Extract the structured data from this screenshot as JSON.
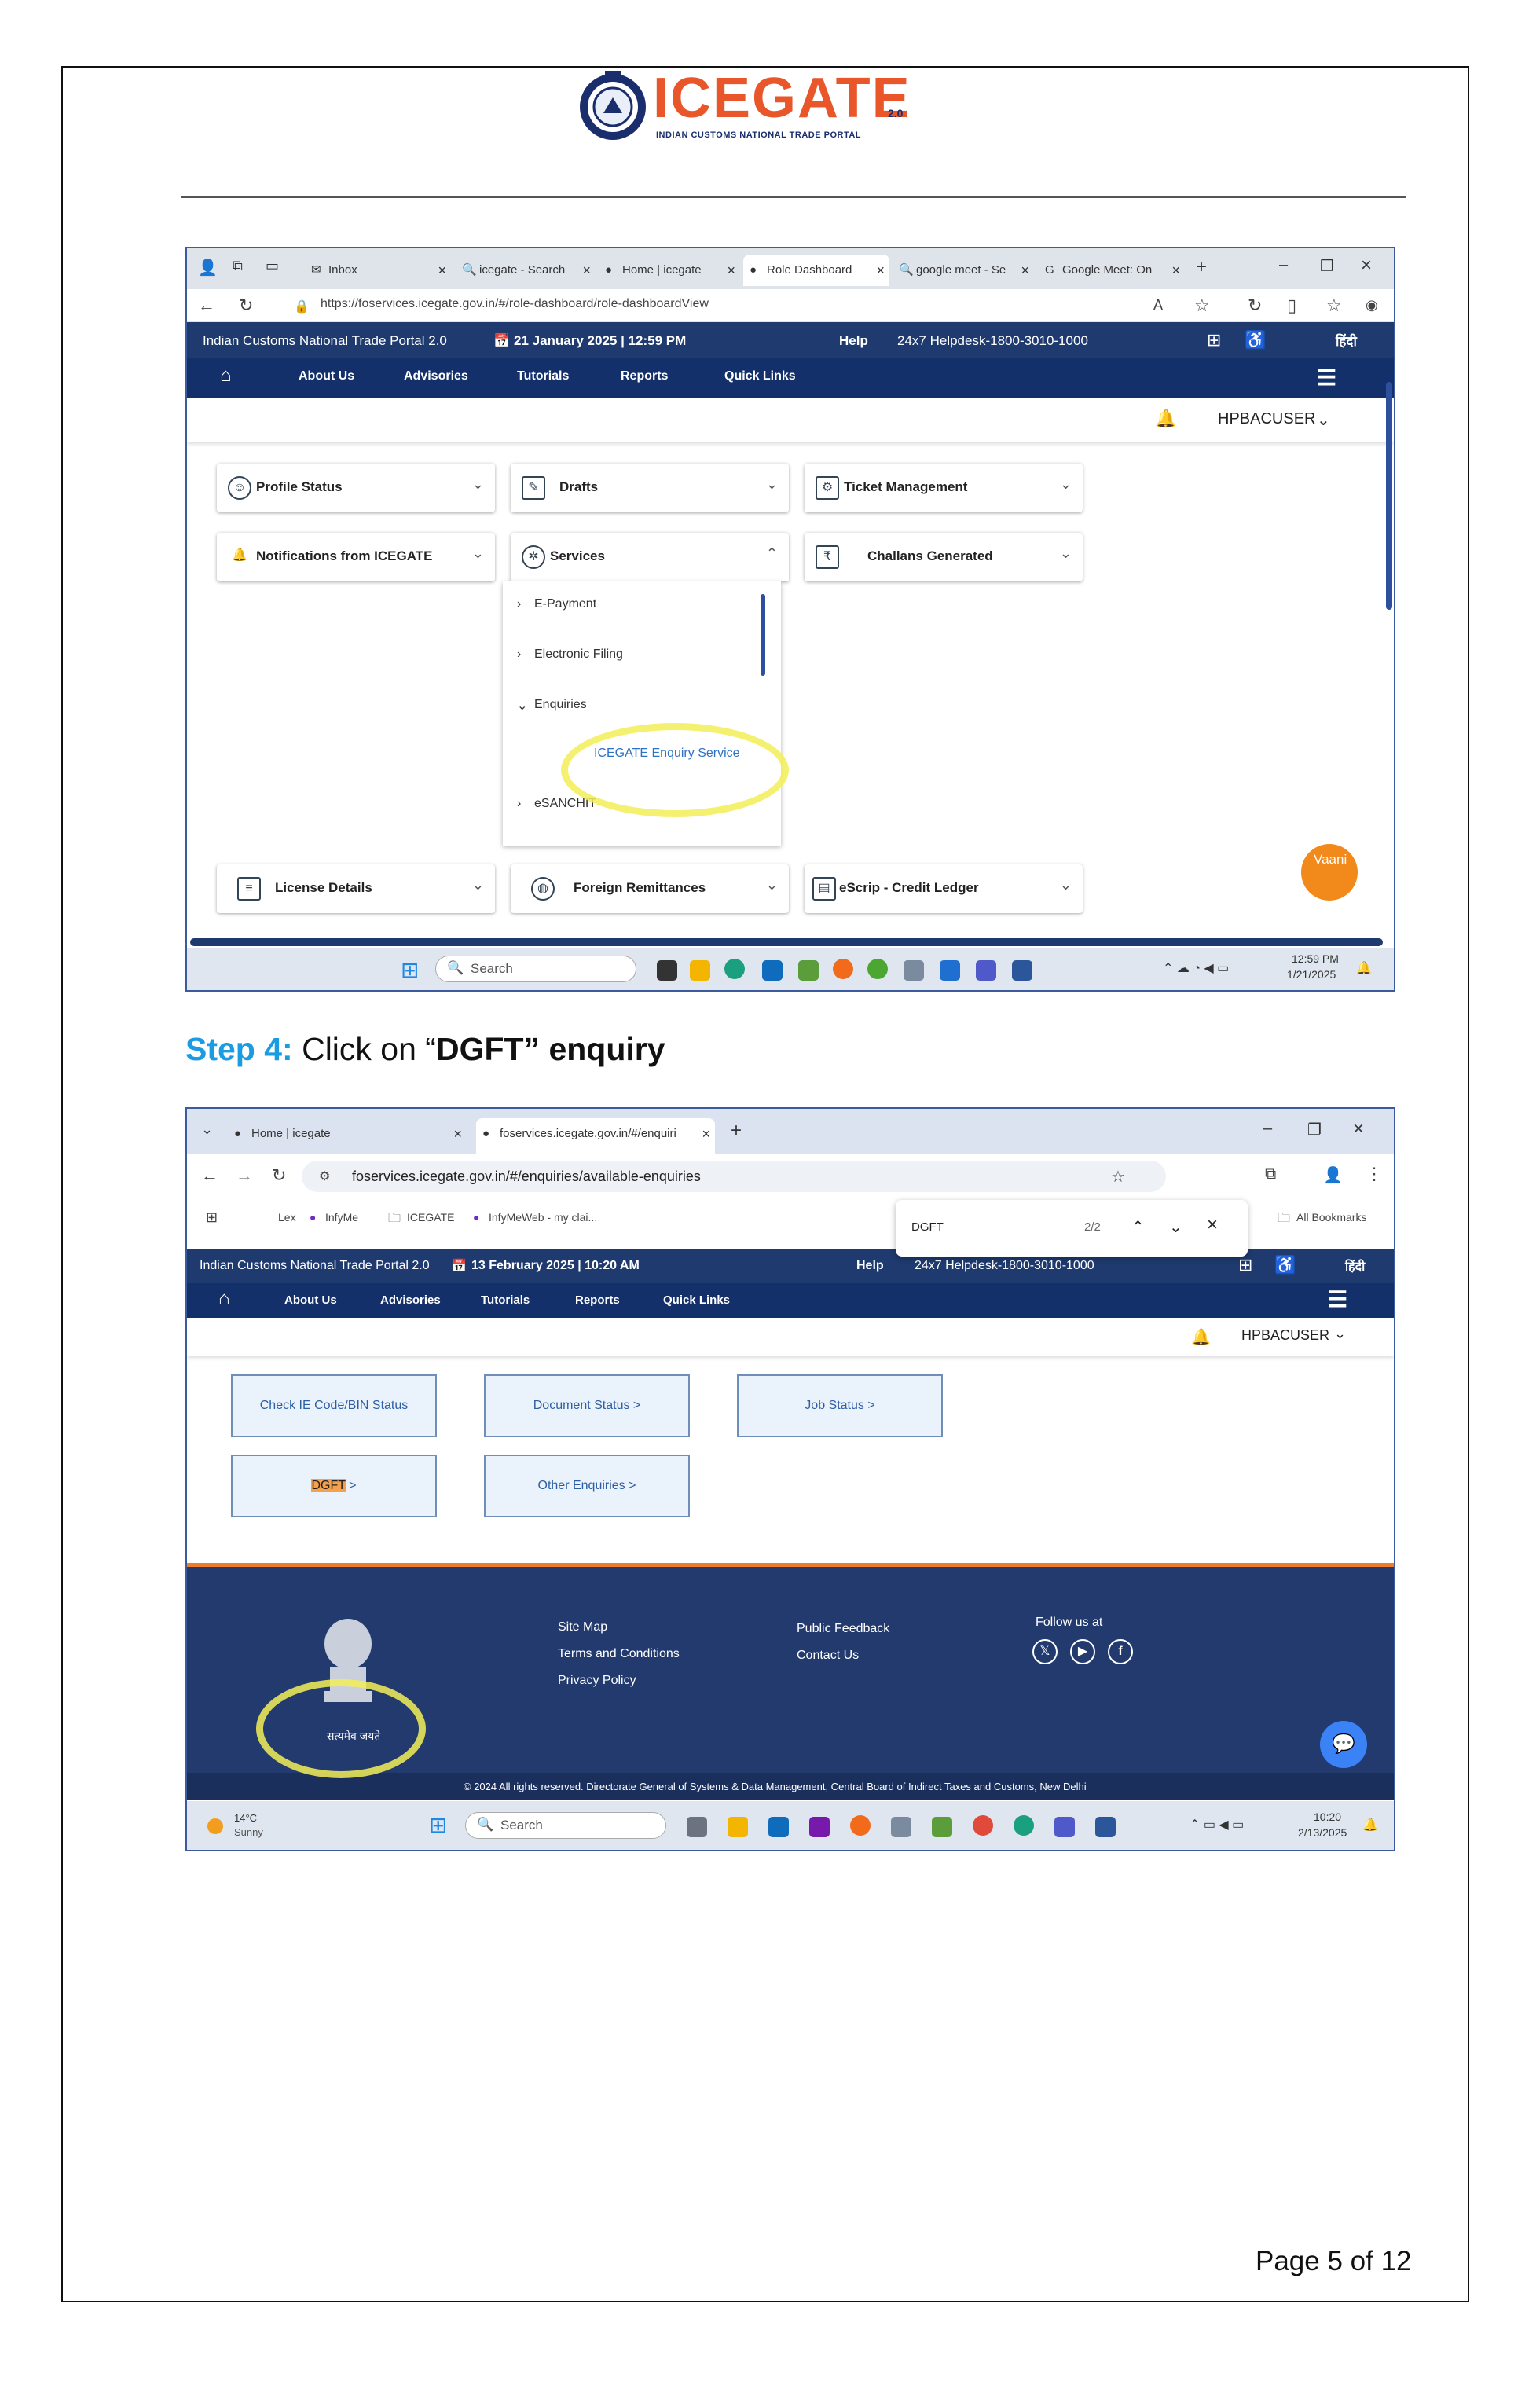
{
  "logo": {
    "wordmark": "ICEGATE",
    "version": "2.0",
    "subtitle": "INDIAN CUSTOMS NATIONAL TRADE PORTAL"
  },
  "step": {
    "prefix": "Step 4:",
    "text_before": " Click on “",
    "bold_word": "DGFT”",
    "text_after": " enquiry"
  },
  "page_footer": "Page 5 of 12",
  "shot1": {
    "tabs": [
      "Inbox",
      "icegate - Search",
      "Home | icegate",
      "Role Dashboard",
      "google meet - Se",
      "Google Meet: On"
    ],
    "url": "https://foservices.icegate.gov.in/#/role-dashboard/role-dashboardView",
    "portal_title": "Indian Customs National Trade Portal 2.0",
    "date": "21 January 2025 | 12:59 PM",
    "help": "Help",
    "helpdesk": "24x7 Helpdesk-1800-3010-1000",
    "hindi": "हिंदी",
    "menu": [
      "About Us",
      "Advisories",
      "Tutorials",
      "Reports",
      "Quick Links"
    ],
    "user": "HPBACUSER",
    "cards": [
      "Profile Status",
      "Drafts",
      "Ticket Management",
      "Notifications from ICEGATE",
      "Services",
      "Challans Generated",
      "License Details",
      "Foreign Remittances",
      "eScrip - Credit Ledger"
    ],
    "services_items": [
      "E-Payment",
      "Electronic Filing",
      "Enquiries",
      "ICEGATE Enquiry Service",
      "eSANCHIT"
    ],
    "chatbot": "Vaani",
    "taskbar": {
      "search": "Search",
      "time": "12:59 PM",
      "date": "1/21/2025"
    }
  },
  "shot2": {
    "tabs": [
      "Home | icegate",
      "foservices.icegate.gov.in/#/enquiri"
    ],
    "url": "foservices.icegate.gov.in/#/enquiries/available-enquiries",
    "bookmarks": [
      "Lex",
      "InfyMe",
      "ICEGATE",
      "InfyMeWeb - my clai...",
      "All Bookmarks"
    ],
    "find": {
      "query": "DGFT",
      "count": "2/2"
    },
    "portal_title": "Indian Customs National Trade Portal 2.0",
    "date": "13 February 2025 | 10:20 AM",
    "help": "Help",
    "helpdesk": "24x7 Helpdesk-1800-3010-1000",
    "hindi": "हिंदी",
    "menu": [
      "About Us",
      "Advisories",
      "Tutorials",
      "Reports",
      "Quick Links"
    ],
    "user": "HPBACUSER",
    "enquiries": [
      "Check IE Code/BIN Status",
      "Document Status >",
      "Job Status >",
      "DGFT",
      " >",
      "Other Enquiries >"
    ],
    "footer_links": [
      "Site Map",
      "Terms and Conditions",
      "Privacy Policy",
      "Public Feedback",
      "Contact Us",
      "Follow us at"
    ],
    "emblem_motto": "सत्यमेव जयते",
    "copyright": "© 2024 All rights reserved. Directorate General of Systems & Data Management, Central Board of Indirect Taxes and Customs, New Delhi",
    "taskbar": {
      "weather_temp": "14°C",
      "weather": "Sunny",
      "search": "Search",
      "time": "10:20",
      "date": "2/13/2025"
    }
  },
  "colors": {
    "accent_blue": "#1a9ce2",
    "navy": "#1e3a6e",
    "highlight": "#f3ef57",
    "orange": "#e8562a"
  }
}
